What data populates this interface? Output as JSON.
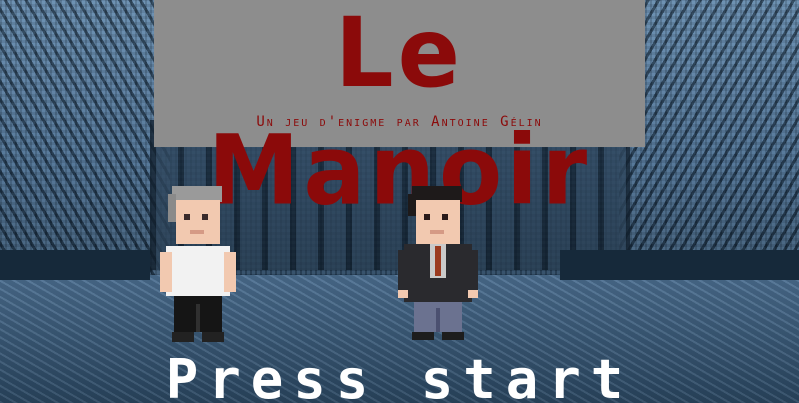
{
  "title": "Le Manoir",
  "subtitle": "Un jeu d'enigme par Antoine Gélin",
  "prompt": "Press start",
  "colors": {
    "title_text": "#8b0a0a",
    "title_card": "#8d8d8d",
    "prompt_text": "#ffffff",
    "background": "#3d6286"
  },
  "characters": [
    "character-white-shirt",
    "character-dark-suit"
  ]
}
